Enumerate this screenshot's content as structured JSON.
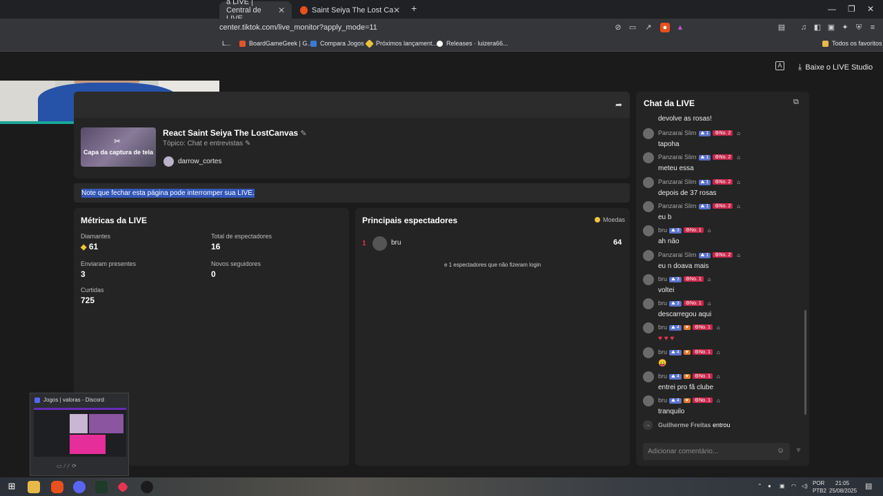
{
  "browser": {
    "tabs": [
      {
        "label": "a LIVE | Central de LIVE",
        "close": "✕"
      },
      {
        "label": "Saint Seiya The Lost Canvas Prison of",
        "close": "✕"
      }
    ],
    "new_tab": "+",
    "url": "center.tiktok.com/live_monitor?apply_mode=11",
    "bookmarks": [
      "L...",
      "BoardGameGeek | G...",
      "Compara Jogos",
      "Próximos lançament...",
      "Releases · luizera66..."
    ],
    "all_bookmarks": "Todos os favoritos"
  },
  "header": {
    "download_label": "Baixe o LIVE Studio"
  },
  "live_info": {
    "cover_label": "Capa da captura de tela",
    "title": "React Saint Seiya The LostCanvas",
    "topic": "Tópico: Chat e entrevistas",
    "host": "darrow_cortes"
  },
  "warning": "Note que fechar esta página pode interromper sua LIVE.",
  "metrics": {
    "title": "Métricas da LIVE",
    "diamonds_label": "Diamantes",
    "diamonds_value": "61",
    "viewers_label": "Total de espectadores",
    "viewers_value": "16",
    "gifts_label": "Enviaram presentes",
    "gifts_value": "3",
    "followers_label": "Novos seguidores",
    "followers_value": "0",
    "likes_label": "Curtidas",
    "likes_value": "725"
  },
  "top_viewers": {
    "title": "Principais espectadores",
    "currency": "Moedas",
    "rows": [
      {
        "rank": "1",
        "name": "bru",
        "coins": "64"
      }
    ],
    "footer": "e 1 espectadores que não fizeram login"
  },
  "chat": {
    "title": "Chat da LIVE",
    "first_text": "devolve as rosas!",
    "messages": [
      {
        "name": "Panzarai Slim",
        "lvl": "1",
        "no": "No. 2",
        "heart": false,
        "text": "tapoha"
      },
      {
        "name": "Panzarai Slim",
        "lvl": "1",
        "no": "No. 2",
        "heart": false,
        "text": "meteu essa"
      },
      {
        "name": "Panzarai Slim",
        "lvl": "1",
        "no": "No. 2",
        "heart": false,
        "text": "depois de 37 rosas"
      },
      {
        "name": "Panzarai Slim",
        "lvl": "1",
        "no": "No. 2",
        "heart": false,
        "text": "eu b"
      },
      {
        "name": "bru",
        "lvl": "3",
        "no": "No. 1",
        "heart": false,
        "text": "ah não"
      },
      {
        "name": "Panzarai Slim",
        "lvl": "1",
        "no": "No. 2",
        "heart": false,
        "text": "eu n doava mais"
      },
      {
        "name": "bru",
        "lvl": "3",
        "no": "No. 1",
        "heart": false,
        "text": "voltei"
      },
      {
        "name": "bru",
        "lvl": "3",
        "no": "No. 1",
        "heart": false,
        "text": "descarregou aqui"
      },
      {
        "name": "bru",
        "lvl": "4",
        "no": "No. 1",
        "heart": true,
        "text": "♥ ♥ ♥"
      },
      {
        "name": "bru",
        "lvl": "4",
        "no": "No. 1",
        "heart": true,
        "text": "😛"
      },
      {
        "name": "bru",
        "lvl": "4",
        "no": "No. 1",
        "heart": true,
        "text": "entrei pro fã clube"
      },
      {
        "name": "bru",
        "lvl": "4",
        "no": "No. 1",
        "heart": true,
        "text": "tranquilo"
      }
    ],
    "join_name": "Guilherme Freitas",
    "join_text": "entrou",
    "input_placeholder": "Adicionar comentário..."
  },
  "discord_preview": {
    "title": "Jogos | valoras - Discord"
  },
  "taskbar": {
    "lang": "POR",
    "layout": "PTB2",
    "time": "21:05",
    "date": "25/08/2025"
  },
  "colors": {
    "accent_red": "#c8284b",
    "level_blue": "#5b73c9",
    "highlight": "#3257b8",
    "coin_yellow": "#f0c33c"
  }
}
